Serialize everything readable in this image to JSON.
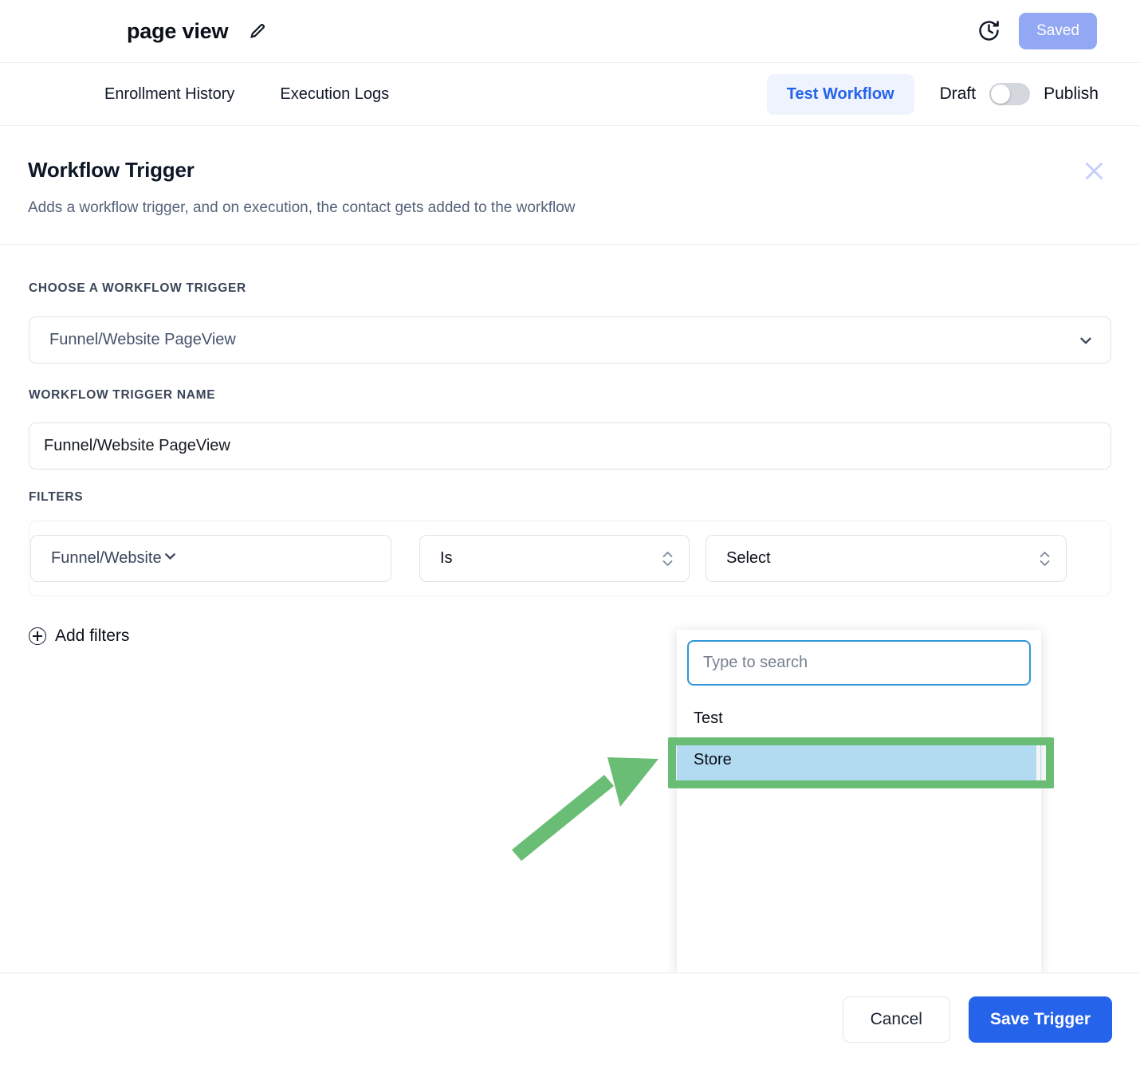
{
  "topbar": {
    "workflow_title": "page view",
    "edit_icon": "pencil-icon",
    "history_icon": "clock-history-icon",
    "saved_button": "Saved",
    "saved_button_color": "#92a8f5"
  },
  "subnav": {
    "tabs": [
      {
        "label": "Enrollment History"
      },
      {
        "label": "Execution Logs"
      }
    ],
    "test_workflow_button": "Test Workflow",
    "test_workflow_color": "#2563eb",
    "draft_label": "Draft",
    "publish_label": "Publish",
    "toggle_state": "draft"
  },
  "panel": {
    "title": "Workflow Trigger",
    "subtitle": "Adds a workflow trigger, and on execution, the contact gets added to the workflow",
    "close_icon": "close-icon"
  },
  "form": {
    "trigger_label": "CHOOSE A WORKFLOW TRIGGER",
    "trigger_value": "Funnel/Website PageView",
    "trigger_name_label": "WORKFLOW TRIGGER NAME",
    "trigger_name_value": "Funnel/Website PageView",
    "filters_label": "FILTERS",
    "filter_row": {
      "property": "Funnel/Website",
      "operator": "Is",
      "value": "Select"
    },
    "add_filters_label": "Add filters",
    "add_filters_icon": "plus-circle-icon"
  },
  "dropdown": {
    "search_placeholder": "Type to search",
    "search_value": "",
    "options": [
      {
        "label": "Test",
        "selected": false
      },
      {
        "label": "Store",
        "selected": true
      }
    ],
    "highlight_color": "#b2daf0"
  },
  "annotation": {
    "color": "#6abd74",
    "target": "Store"
  },
  "footer": {
    "cancel_label": "Cancel",
    "save_label": "Save Trigger",
    "save_color": "#2563eb"
  }
}
